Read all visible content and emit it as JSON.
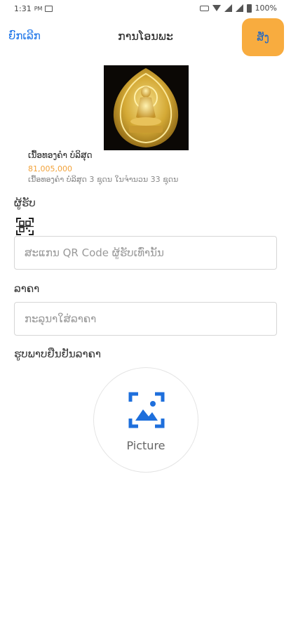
{
  "status_bar": {
    "time": "1:31",
    "am_pm": "PM",
    "battery": "100%",
    "icons": [
      "image-icon",
      "keyboard-icon",
      "wifi-icon",
      "signal-icon",
      "signal-icon",
      "battery-icon"
    ]
  },
  "header": {
    "cancel_label": "ຍົກເລີກ",
    "title": "ການໂອນພະ",
    "order_label": "ສັ່ງ",
    "accent_color": "#f8ac3f",
    "link_color": "#1a73e8"
  },
  "product": {
    "name": "ເນື້ອທອງຄຳ ບໍລິສຸດ",
    "price": "81,005,000",
    "price_color": "#f2a23a",
    "description": "ເນື້ອທອງຄຳ ບໍລິສຸດ 3 ຊຸດນ ໃນຈຳນວນ 33 ຊຸດນ"
  },
  "receiver": {
    "label": "ຜູ້ຮັບ",
    "qr_icon": "qr-scan-icon",
    "placeholder": "ສະແກນ QR Code ຜູ້ຮັບເທົ່ານັ້ນ"
  },
  "price_field": {
    "label": "ລາຄາ",
    "placeholder": "ກະລຸນາໃສ່ລາຄາ"
  },
  "photo": {
    "label": "ຮູບພາບຢືນຢັນລາຄາ",
    "icon": "image-upload-icon",
    "button_label": "Picture",
    "icon_color": "#1e6fdc"
  }
}
